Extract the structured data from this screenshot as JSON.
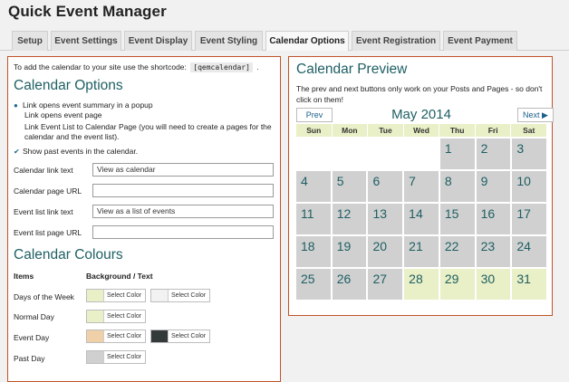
{
  "app": {
    "title": "Quick Event Manager"
  },
  "tabs": [
    {
      "label": "Setup"
    },
    {
      "label": "Event Settings"
    },
    {
      "label": "Event Display"
    },
    {
      "label": "Event Styling"
    },
    {
      "label": "Calendar Options",
      "active": true
    },
    {
      "label": "Event Registration"
    },
    {
      "label": "Event Payment"
    }
  ],
  "left": {
    "intro_prefix": "To add the calendar to your site use the shortcode:",
    "shortcode": "[qemcalendar]",
    "intro_suffix": ".",
    "options_heading": "Calendar Options",
    "options": [
      {
        "mark": "radio-selected",
        "label": "Link opens event summary in a popup"
      },
      {
        "mark": "none",
        "label": "Link opens event page"
      },
      {
        "mark": "none",
        "label": "Link Event List to Calendar Page (you will need to create a pages for the calendar and the event list)."
      },
      {
        "mark": "check",
        "label": "Show past events in the calendar."
      }
    ],
    "fields": [
      {
        "label": "Calendar link text",
        "value": "View as calendar"
      },
      {
        "label": "Calendar page URL",
        "value": ""
      },
      {
        "label": "Event list link text",
        "value": "View as a list of events"
      },
      {
        "label": "Event list page URL",
        "value": ""
      }
    ],
    "colours_heading": "Calendar Colours",
    "col_items": "Items",
    "col_bg_text": "Background / Text",
    "colour_rows": [
      {
        "label": "Days of the Week",
        "bg": {
          "color": "#e9efc6",
          "label": "Select Color"
        },
        "text": {
          "color": "#f2f2f2",
          "label": "Select Color"
        }
      },
      {
        "label": "Normal Day",
        "bg": {
          "color": "#e9efc6",
          "label": "Select Color"
        }
      },
      {
        "label": "Event Day",
        "bg": {
          "color": "#efd0a8",
          "label": "Select Color"
        },
        "text": {
          "color": "#343a3a",
          "label": "Select Color"
        }
      },
      {
        "label": "Past Day",
        "bg": {
          "color": "#d0d0d0",
          "label": "Select Color"
        }
      }
    ]
  },
  "preview": {
    "title": "Calendar Preview",
    "note": "The prev and next buttons only work on your Posts and Pages - so don't click on them!",
    "prev_label": "Prev",
    "next_label": "Next ▶",
    "month": "May 2014",
    "weekdays": [
      "Sun",
      "Mon",
      "Tue",
      "Wed",
      "Thu",
      "Fri",
      "Sat"
    ],
    "weeks": [
      [
        {
          "d": "",
          "t": "blank"
        },
        {
          "d": "",
          "t": "blank"
        },
        {
          "d": "",
          "t": "blank"
        },
        {
          "d": "",
          "t": "blank"
        },
        {
          "d": "1",
          "t": "past"
        },
        {
          "d": "2",
          "t": "past"
        },
        {
          "d": "3",
          "t": "past"
        }
      ],
      [
        {
          "d": "4",
          "t": "past"
        },
        {
          "d": "5",
          "t": "past"
        },
        {
          "d": "6",
          "t": "past"
        },
        {
          "d": "7",
          "t": "past"
        },
        {
          "d": "8",
          "t": "past"
        },
        {
          "d": "9",
          "t": "past"
        },
        {
          "d": "10",
          "t": "past"
        }
      ],
      [
        {
          "d": "11",
          "t": "past"
        },
        {
          "d": "12",
          "t": "past"
        },
        {
          "d": "13",
          "t": "past"
        },
        {
          "d": "14",
          "t": "past"
        },
        {
          "d": "15",
          "t": "past"
        },
        {
          "d": "16",
          "t": "past"
        },
        {
          "d": "17",
          "t": "past"
        }
      ],
      [
        {
          "d": "18",
          "t": "past"
        },
        {
          "d": "19",
          "t": "past"
        },
        {
          "d": "20",
          "t": "past"
        },
        {
          "d": "21",
          "t": "past"
        },
        {
          "d": "22",
          "t": "past"
        },
        {
          "d": "23",
          "t": "past"
        },
        {
          "d": "24",
          "t": "past"
        }
      ],
      [
        {
          "d": "25",
          "t": "past"
        },
        {
          "d": "26",
          "t": "past"
        },
        {
          "d": "27",
          "t": "past"
        },
        {
          "d": "28",
          "t": "normal"
        },
        {
          "d": "29",
          "t": "normal"
        },
        {
          "d": "30",
          "t": "normal"
        },
        {
          "d": "31",
          "t": "normal"
        }
      ]
    ]
  }
}
